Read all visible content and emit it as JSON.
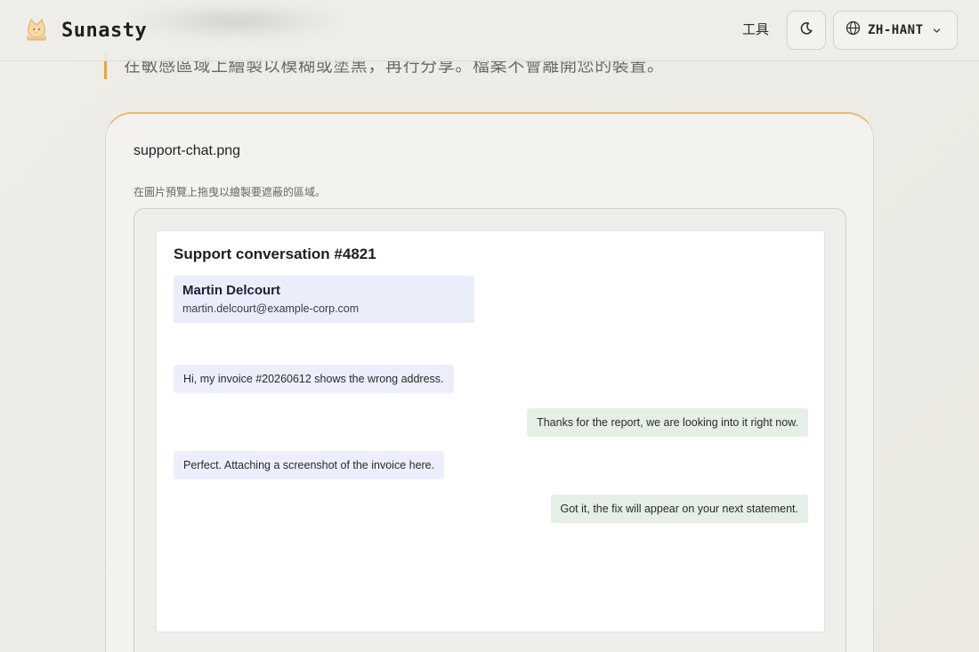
{
  "header": {
    "brand_name": "Sunasty",
    "logo_icon": "cat-logo-icon",
    "nav_tools_label": "工具",
    "theme_toggle_icon": "moon-icon",
    "language": {
      "icon": "globe-icon",
      "selected": "ZH-HANT",
      "chevron_icon": "chevron-down-icon"
    }
  },
  "intro": {
    "text": "在敏感區域上繪製以模糊或塗黑，再行分享。檔案不會離開您的裝置。",
    "accent_color": "#e9a347"
  },
  "editor": {
    "file_name": "support-chat.png",
    "hint": "在圖片預覽上拖曳以繪製要遮蔽的區域。",
    "preview": {
      "title": "Support conversation #4821",
      "contact_name": "Martin Delcourt",
      "contact_email": "martin.delcourt@example-corp.com",
      "messages": [
        {
          "direction": "incoming",
          "text": "Hi, my invoice #20260612 shows the wrong address."
        },
        {
          "direction": "outgoing",
          "text": "Thanks for the report, we are looking into it right now."
        },
        {
          "direction": "incoming",
          "text": "Perfect. Attaching a screenshot of the invoice here."
        },
        {
          "direction": "outgoing",
          "text": "Got it, the fix will appear on your next statement."
        }
      ]
    }
  }
}
